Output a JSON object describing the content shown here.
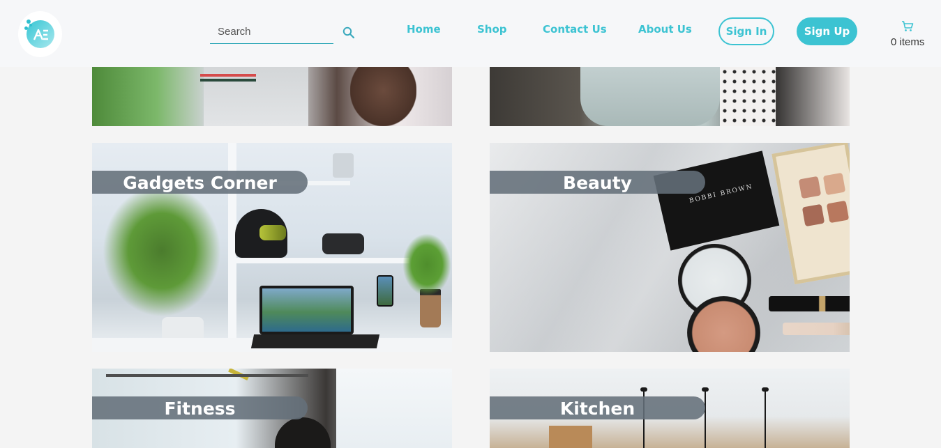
{
  "header": {
    "search": {
      "placeholder": "Search",
      "value": ""
    },
    "nav": [
      {
        "label": "Home"
      },
      {
        "label": "Shop"
      },
      {
        "label": "Contact Us"
      },
      {
        "label": "About Us"
      }
    ],
    "signin_label": "Sign In",
    "signup_label": "Sign Up",
    "cart": {
      "count_text": "0 items"
    }
  },
  "categories": [
    {
      "label": ""
    },
    {
      "label": ""
    },
    {
      "label": "Gadgets Corner"
    },
    {
      "label": "Beauty"
    },
    {
      "label": "Fitness"
    },
    {
      "label": "Kitchen"
    }
  ],
  "colors": {
    "accent": "#3cc3d2",
    "header_bg": "#f6f7f9",
    "page_bg": "#f4f4f4",
    "label_bg": "#64707a"
  },
  "icons": {
    "logo": "brand-logo",
    "search": "search-icon",
    "cart": "cart-icon"
  }
}
